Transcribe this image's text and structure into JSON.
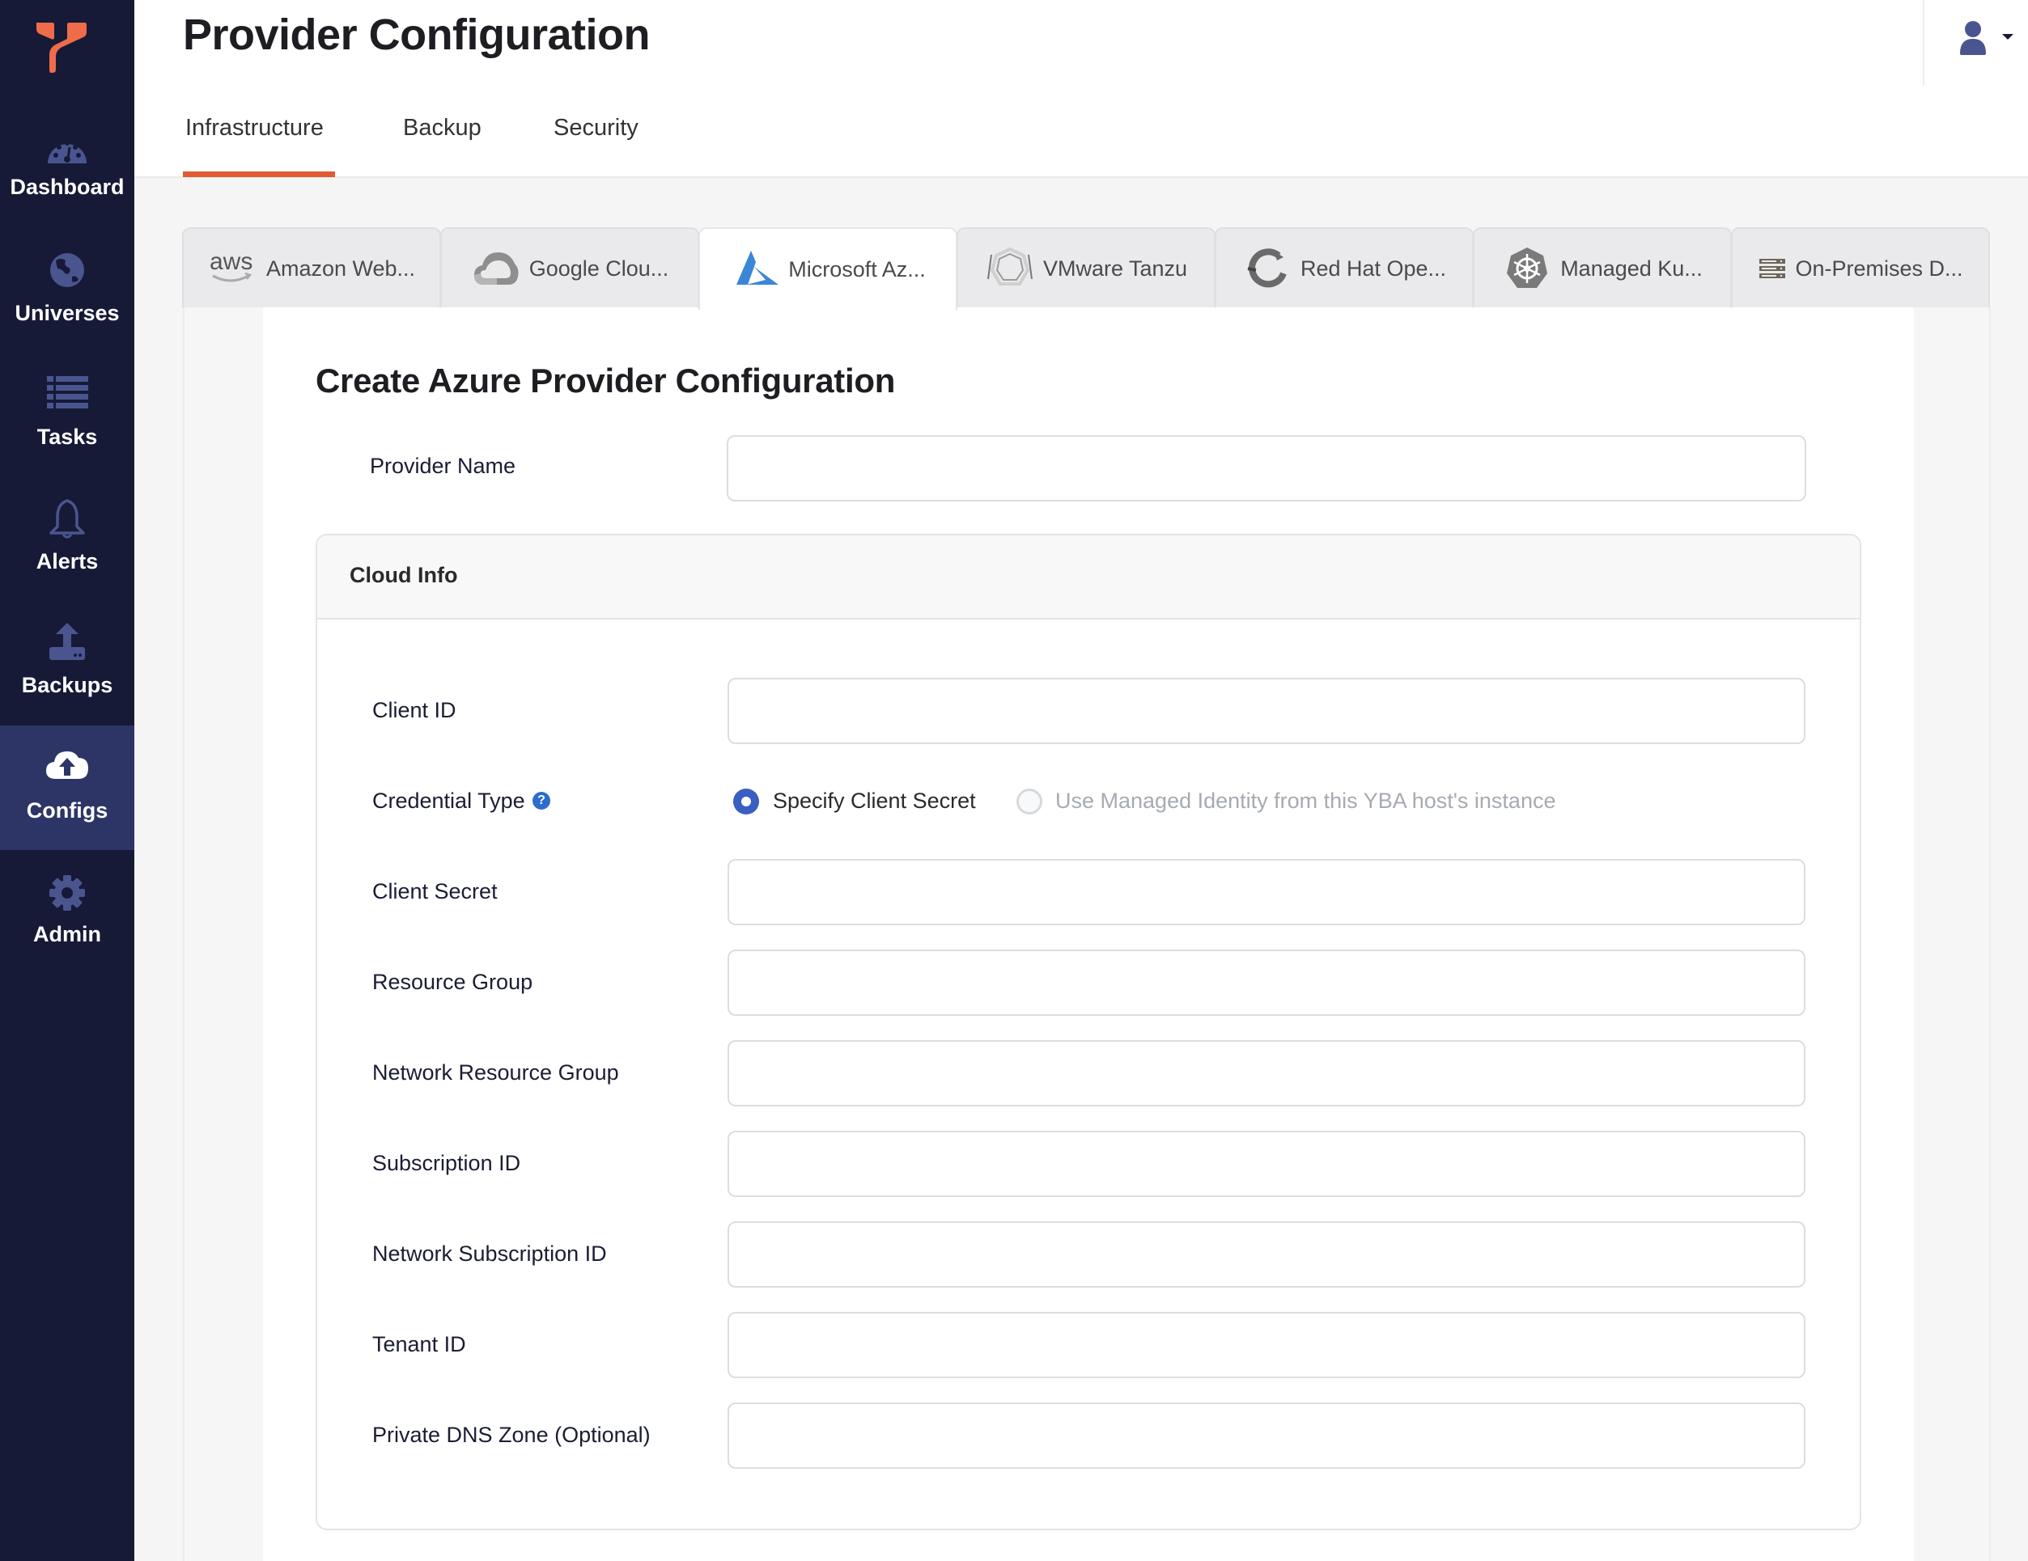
{
  "sidebar": {
    "brand_color": "#ef6c4a",
    "items": [
      {
        "label": "Dashboard",
        "icon": "dashboard-gauge-icon"
      },
      {
        "label": "Universes",
        "icon": "globe-icon"
      },
      {
        "label": "Tasks",
        "icon": "list-icon"
      },
      {
        "label": "Alerts",
        "icon": "bell-icon"
      },
      {
        "label": "Backups",
        "icon": "upload-icon"
      },
      {
        "label": "Configs",
        "icon": "cloud-upload-icon",
        "active": true
      },
      {
        "label": "Admin",
        "icon": "gear-icon"
      }
    ]
  },
  "header": {
    "title": "Provider Configuration",
    "tabs": [
      {
        "label": "Infrastructure",
        "active": true
      },
      {
        "label": "Backup"
      },
      {
        "label": "Security"
      }
    ],
    "accent_color": "#e05a32"
  },
  "provider_tabs": [
    {
      "label": "Amazon Web...",
      "icon": "aws-icon"
    },
    {
      "label": "Google Clou...",
      "icon": "google-cloud-icon"
    },
    {
      "label": "Microsoft Az...",
      "icon": "azure-icon",
      "active": true
    },
    {
      "label": "VMware Tanzu",
      "icon": "vmware-tanzu-icon"
    },
    {
      "label": "Red Hat Ope...",
      "icon": "openshift-icon"
    },
    {
      "label": "Managed Ku...",
      "icon": "kubernetes-icon"
    },
    {
      "label": "On-Premises D...",
      "icon": "server-icon"
    }
  ],
  "form": {
    "title": "Create Azure Provider Configuration",
    "provider_name": {
      "label": "Provider Name",
      "value": ""
    },
    "cloud_info": {
      "title": "Cloud Info",
      "client_id": {
        "label": "Client ID",
        "value": ""
      },
      "credential_type": {
        "label": "Credential Type",
        "help": "?",
        "options": [
          {
            "label": "Specify Client Secret",
            "checked": true
          },
          {
            "label": "Use Managed Identity from this YBA host's instance",
            "checked": false,
            "disabled": true
          }
        ]
      },
      "client_secret": {
        "label": "Client Secret",
        "value": ""
      },
      "resource_group": {
        "label": "Resource Group",
        "value": ""
      },
      "network_resource_group": {
        "label": "Network Resource Group",
        "value": ""
      },
      "subscription_id": {
        "label": "Subscription ID",
        "value": ""
      },
      "network_subscription_id": {
        "label": "Network Subscription ID",
        "value": ""
      },
      "tenant_id": {
        "label": "Tenant ID",
        "value": ""
      },
      "private_dns_zone": {
        "label": "Private DNS Zone (Optional)",
        "value": ""
      }
    }
  },
  "colors": {
    "sidebar_bg": "#161a36",
    "sidebar_active_bg": "#2c3565",
    "radio_checked": "#3b5ec2",
    "help_icon": "#2a6dcc",
    "azure_blue": "#3a87d6"
  }
}
